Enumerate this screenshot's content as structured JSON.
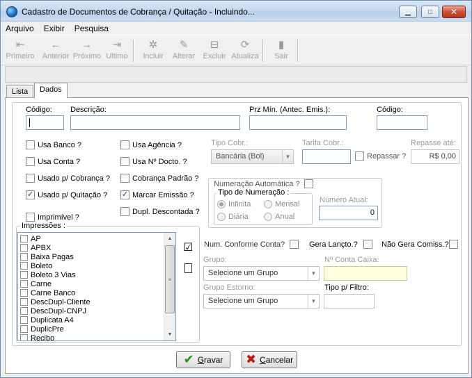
{
  "window": {
    "title": "Cadastro de Documentos de Cobrança / Quitação - Incluindo...",
    "minimize": "▁",
    "maximize": "□",
    "close": "✕"
  },
  "menu": [
    "Arquivo",
    "Exibir",
    "Pesquisa"
  ],
  "toolbar": {
    "primeiro": "Primeiro",
    "anterior": "Anterior",
    "proximo": "Próximo",
    "ultimo": "Ultimo",
    "incluir": "Incluir",
    "alterar": "Alterar",
    "excluir": "Excluir",
    "atualiza": "Atualiza",
    "sair": "Sair"
  },
  "tabs": [
    "Lista",
    "Dados"
  ],
  "form": {
    "codigo_label": "Código:",
    "codigo_value": "",
    "descricao_label": "Descrição:",
    "descricao_value": "",
    "prz_label": "Prz Mín. (Antec. Emis.):",
    "codigo2_label": "Código:",
    "usa_banco": "Usa Banco ?",
    "usa_conta": "Usa Conta ?",
    "usado_cobranca": "Usado p/ Cobrança ?",
    "usado_quitacao": "Usado p/ Quitação ?",
    "imprimivel": "Imprimível ?",
    "usa_agencia": "Usa Agência ?",
    "usa_ndocto": "Usa Nº Docto. ?",
    "cobranca_padrao": "Cobrança Padrão ?",
    "marcar_emissao": "Marcar Emissão ?",
    "dupl_descontada": "Dupl. Descontada ?",
    "tipo_cobr_label": "Tipo Cobr.:",
    "tipo_cobr_value": "Bancária (Bol)",
    "tarifa_label": "Tarifa Cobr.:",
    "repassar": "Repassar ?",
    "repasse_label": "Repasse até:",
    "repasse_value": "R$ 0,00",
    "numeracao_auto": "Numeração Automática ?",
    "tipo_numeracao": "Tipo de Numeração :",
    "infinita": "Infinita",
    "mensal": "Mensal",
    "diaria": "Diária",
    "anual": "Anual",
    "numero_atual_label": "Número Atual:",
    "numero_atual_value": "0",
    "impressoes_label": "Impressões :",
    "num_conforme_conta": "Num. Conforme Conta?",
    "gera_lancto": "Gera Lançto.?",
    "nao_gera_comiss": "Não Gera Comiss.?",
    "grupo_label": "Grupo:",
    "grupo_value": "Selecione um Grupo",
    "nconta_caixa_label": "Nº Conta Caixa:",
    "grupo_estorno_label": "Grupo Estorno:",
    "grupo_estorno_value": "Selecione um Grupo",
    "tipo_filtro_label": "Tipo p/ Filtro:"
  },
  "impressoes": [
    "AP",
    "APBX",
    "Baixa Pagas",
    "Boleto",
    "Boleto 3 Vias",
    "Carne",
    "Carne Banco",
    "DescDupl-Cliente",
    "DescDupl-CNPJ",
    "Duplicata A4",
    "DuplicPre",
    "Recibo"
  ],
  "buttons": {
    "gravar_mnemonic": "G",
    "gravar_rest": "ravar",
    "cancelar_mnemonic": "C",
    "cancelar_rest": "ancelar"
  }
}
